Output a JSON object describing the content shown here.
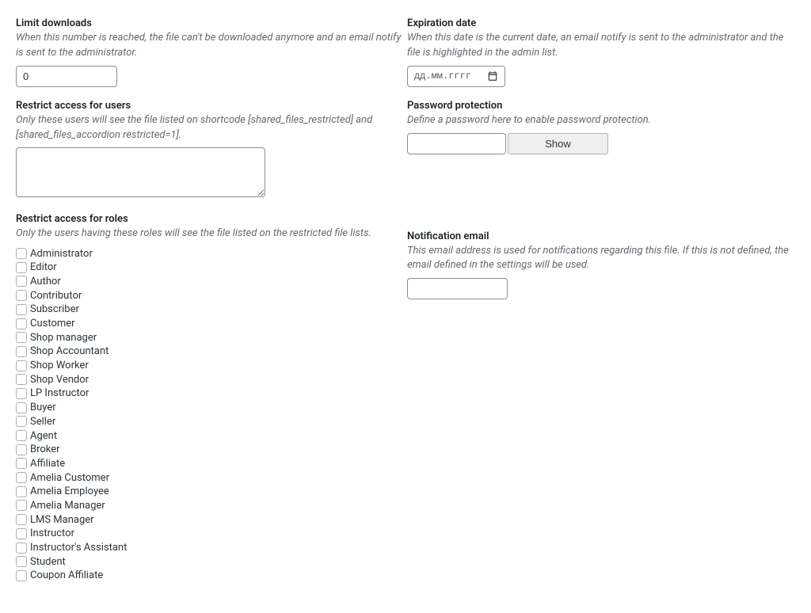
{
  "left": {
    "limit": {
      "label": "Limit downloads",
      "desc": "When this number is reached, the file can't be downloaded anymore and an email notify is sent to the administrator.",
      "value": "0"
    },
    "restrict_users": {
      "label": "Restrict access for users",
      "desc": "Only these users will see the file listed on shortcode [shared_files_restricted] and [shared_files_accordion restricted=1].",
      "value": ""
    },
    "restrict_roles": {
      "label": "Restrict access for roles",
      "desc": "Only the users having these roles will see the file listed on the restricted file lists.",
      "roles": [
        "Administrator",
        "Editor",
        "Author",
        "Contributor",
        "Subscriber",
        "Customer",
        "Shop manager",
        "Shop Accountant",
        "Shop Worker",
        "Shop Vendor",
        "LP Instructor",
        "Buyer",
        "Seller",
        "Agent",
        "Broker",
        "Affiliate",
        "Amelia Customer",
        "Amelia Employee",
        "Amelia Manager",
        "LMS Manager",
        "Instructor",
        "Instructor's Assistant",
        "Student",
        "Coupon Affiliate"
      ]
    }
  },
  "right": {
    "expiration": {
      "label": "Expiration date",
      "desc": "When this date is the current date, an email notify is sent to the administrator and the file is highlighted in the admin list.",
      "placeholder": "дд.мм.гггг"
    },
    "password": {
      "label": "Password protection",
      "desc": "Define a password here to enable password protection.",
      "show_label": "Show"
    },
    "notification": {
      "label": "Notification email",
      "desc": "This email address is used for notifications regarding this file. If this is not defined, the email defined in the settings will be used."
    }
  }
}
